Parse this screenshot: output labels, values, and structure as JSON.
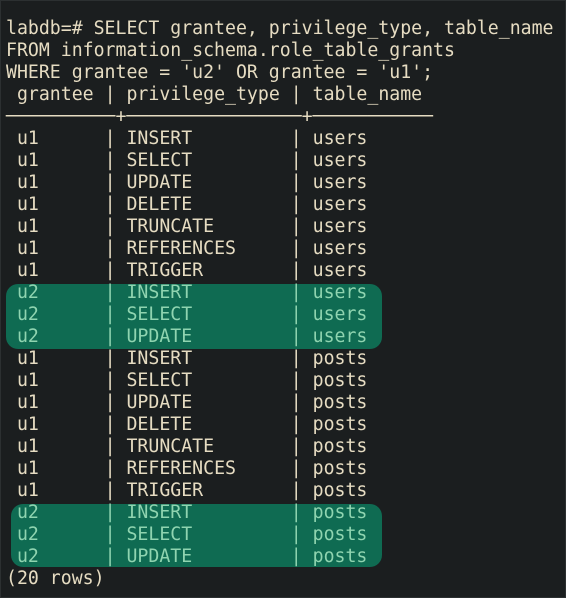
{
  "terminal": {
    "prompt": "labdb=# ",
    "query_lines": [
      "SELECT grantee, privilege_type, table_name",
      "FROM information_schema.role_table_grants",
      "WHERE grantee = 'u2' OR grantee = 'u1';"
    ],
    "columns": [
      "grantee",
      "privilege_type",
      "table_name"
    ],
    "rows": [
      [
        "u1",
        "INSERT",
        "users"
      ],
      [
        "u1",
        "SELECT",
        "users"
      ],
      [
        "u1",
        "UPDATE",
        "users"
      ],
      [
        "u1",
        "DELETE",
        "users"
      ],
      [
        "u1",
        "TRUNCATE",
        "users"
      ],
      [
        "u1",
        "REFERENCES",
        "users"
      ],
      [
        "u1",
        "TRIGGER",
        "users"
      ],
      [
        "u2",
        "INSERT",
        "users"
      ],
      [
        "u2",
        "SELECT",
        "users"
      ],
      [
        "u2",
        "UPDATE",
        "users"
      ],
      [
        "u1",
        "INSERT",
        "posts"
      ],
      [
        "u1",
        "SELECT",
        "posts"
      ],
      [
        "u1",
        "UPDATE",
        "posts"
      ],
      [
        "u1",
        "DELETE",
        "posts"
      ],
      [
        "u1",
        "TRUNCATE",
        "posts"
      ],
      [
        "u1",
        "REFERENCES",
        "posts"
      ],
      [
        "u1",
        "TRIGGER",
        "posts"
      ],
      [
        "u2",
        "INSERT",
        "posts"
      ],
      [
        "u2",
        "SELECT",
        "posts"
      ],
      [
        "u2",
        "UPDATE",
        "posts"
      ]
    ],
    "highlighted_grantee": "u2",
    "footer": "(20 rows)",
    "colors": {
      "background": "#1b1e1f",
      "text": "#e6dcc2",
      "highlight": "#0f6b52",
      "highlight_text": "#8fd4b0"
    }
  }
}
